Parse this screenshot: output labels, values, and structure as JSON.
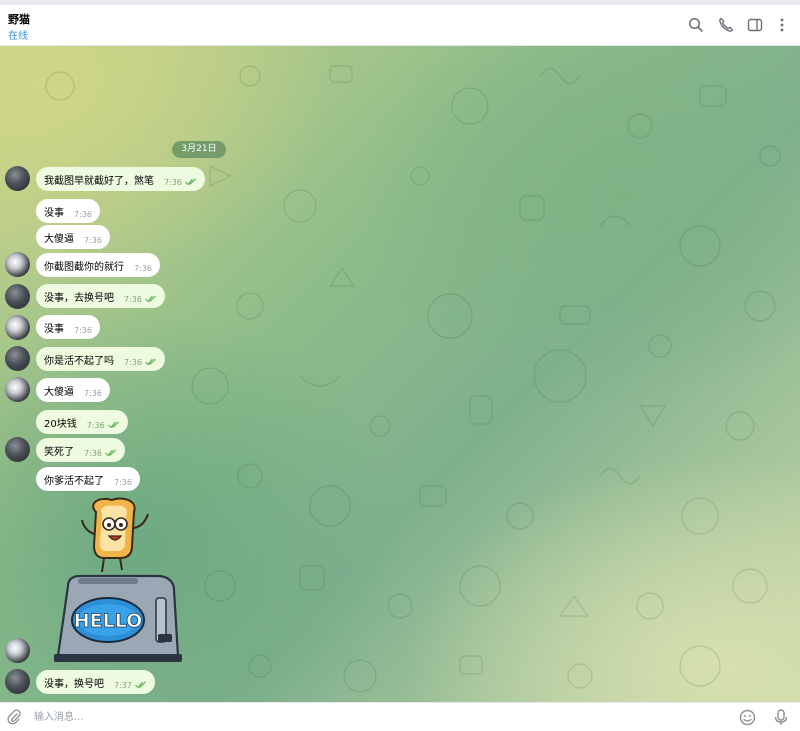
{
  "header": {
    "contact_name": "野猫",
    "status": "在线",
    "icons": [
      "search-icon",
      "phone-icon",
      "sidebar-icon",
      "more-icon"
    ]
  },
  "chat": {
    "date_label": "3月21日",
    "messages": [
      {
        "text": "我截图早就截好了，煞笔",
        "time": "7:36",
        "direction": "out",
        "read": true
      },
      {
        "text": "没事",
        "time": "7:36",
        "direction": "in",
        "read": false
      },
      {
        "text": "大傻逼",
        "time": "7:36",
        "direction": "in",
        "read": false
      },
      {
        "text": "你截图截你的就行",
        "time": "7:36",
        "direction": "in",
        "read": false
      },
      {
        "text": "没事，去换号吧",
        "time": "7:36",
        "direction": "out",
        "read": true
      },
      {
        "text": "没事",
        "time": "7:36",
        "direction": "in",
        "read": false
      },
      {
        "text": "你是活不起了吗",
        "time": "7:36",
        "direction": "out",
        "read": true
      },
      {
        "text": "大傻逼",
        "time": "7:36",
        "direction": "in",
        "read": false
      },
      {
        "text": "20块钱",
        "time": "7:36",
        "direction": "out",
        "read": true
      },
      {
        "text": "笑死了",
        "time": "7:36",
        "direction": "out",
        "read": true
      },
      {
        "text": "你爹活不起了",
        "time": "7:36",
        "direction": "in",
        "read": false
      },
      {
        "text": "没事，换号吧",
        "time": "7:37",
        "direction": "out",
        "read": true
      }
    ],
    "sticker": {
      "caption": "HELLO",
      "description": "toast-toaster-hello-sticker"
    }
  },
  "composer": {
    "placeholder": "输入消息..."
  },
  "colors": {
    "outgoing_bubble": "#eefbe0",
    "incoming_bubble": "#ffffff",
    "status_blue": "#3a8fd6",
    "tick_green": "#5fb35a"
  }
}
